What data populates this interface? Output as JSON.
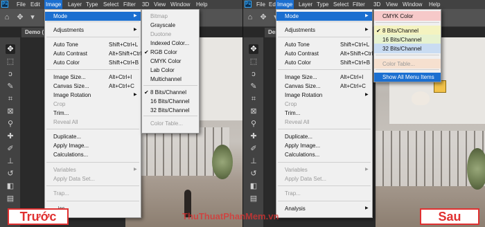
{
  "menubar": {
    "logo": "Ps",
    "items": [
      "File",
      "Edit",
      "Image",
      "Layer",
      "Type",
      "Select",
      "Filter",
      "3D",
      "View",
      "Window",
      "Help"
    ]
  },
  "left": {
    "doc_tab": "Demo (",
    "label": "Trước",
    "image_menu": [
      {
        "label": "Mode",
        "has_sub": true,
        "hl": true
      },
      {
        "label": "Adjustments",
        "has_sub": true
      },
      {
        "label": "Auto Tone",
        "shortcut": "Shift+Ctrl+L"
      },
      {
        "label": "Auto Contrast",
        "shortcut": "Alt+Shift+Ctrl+L"
      },
      {
        "label": "Auto Color",
        "shortcut": "Shift+Ctrl+B"
      },
      {
        "label": "Image Size...",
        "shortcut": "Alt+Ctrl+I"
      },
      {
        "label": "Canvas Size...",
        "shortcut": "Alt+Ctrl+C"
      },
      {
        "label": "Image Rotation",
        "has_sub": true
      },
      {
        "label": "Crop",
        "disabled": true
      },
      {
        "label": "Trim..."
      },
      {
        "label": "Reveal All",
        "disabled": true
      },
      {
        "label": "Duplicate..."
      },
      {
        "label": "Apply Image..."
      },
      {
        "label": "Calculations..."
      },
      {
        "label": "Variables",
        "has_sub": true,
        "disabled": true
      },
      {
        "label": "Apply Data Set...",
        "disabled": true
      },
      {
        "label": "Trap...",
        "disabled": true
      },
      {
        "label": "...ics",
        "disabled": false
      }
    ],
    "mode_menu": [
      {
        "label": "Bitmap",
        "disabled": true
      },
      {
        "label": "Grayscale"
      },
      {
        "label": "Duotone",
        "disabled": true
      },
      {
        "label": "Indexed Color..."
      },
      {
        "label": "RGB Color",
        "checked": true
      },
      {
        "label": "CMYK Color"
      },
      {
        "label": "Lab Color"
      },
      {
        "label": "Multichannel"
      },
      {
        "label": "8 Bits/Channel",
        "checked": true
      },
      {
        "label": "16 Bits/Channel"
      },
      {
        "label": "32 Bits/Channel"
      },
      {
        "label": "Color Table...",
        "disabled": true
      }
    ]
  },
  "right": {
    "doc_tab": "Demo (",
    "label": "Sau",
    "image_menu": [
      {
        "label": "Mode",
        "has_sub": true,
        "hl": true
      },
      {
        "label": "Adjustments",
        "has_sub": true
      },
      {
        "label": "Auto Tone",
        "shortcut": "Shift+Ctrl+L"
      },
      {
        "label": "Auto Contrast",
        "shortcut": "Alt+Shift+Ctrl+L"
      },
      {
        "label": "Auto Color",
        "shortcut": "Shift+Ctrl+B"
      },
      {
        "label": "Image Size...",
        "shortcut": "Alt+Ctrl+I"
      },
      {
        "label": "Canvas Size...",
        "shortcut": "Alt+Ctrl+C"
      },
      {
        "label": "Image Rotation",
        "has_sub": true
      },
      {
        "label": "Crop",
        "disabled": true
      },
      {
        "label": "Trim..."
      },
      {
        "label": "Reveal All",
        "disabled": true
      },
      {
        "label": "Duplicate..."
      },
      {
        "label": "Apply Image..."
      },
      {
        "label": "Calculations..."
      },
      {
        "label": "Variables",
        "has_sub": true,
        "disabled": true
      },
      {
        "label": "Apply Data Set...",
        "disabled": true
      },
      {
        "label": "Trap...",
        "disabled": true
      },
      {
        "label": "Analysis",
        "has_sub": true
      }
    ],
    "mode_menu": [
      {
        "label": "CMYK Color",
        "band": "#f6c9c9"
      },
      {
        "label": "8 Bits/Channel",
        "checked": true,
        "band": "#f4f3c0"
      },
      {
        "label": "16 Bits/Channel",
        "band": "#e7f2cf"
      },
      {
        "label": "32 Bits/Channel",
        "band": "#c9dcf2"
      },
      {
        "label": "Color Table...",
        "disabled": true,
        "band": "#f6e0cf"
      },
      {
        "label": "Show All Menu Items",
        "hl": true
      }
    ]
  },
  "watermark": "ThuThuatPhanMem.vn",
  "colors": {
    "accent": "#1b6fd0",
    "label_red": "#e03131",
    "menu_bg": "#f0f0f0",
    "app_bg": "#282828"
  }
}
